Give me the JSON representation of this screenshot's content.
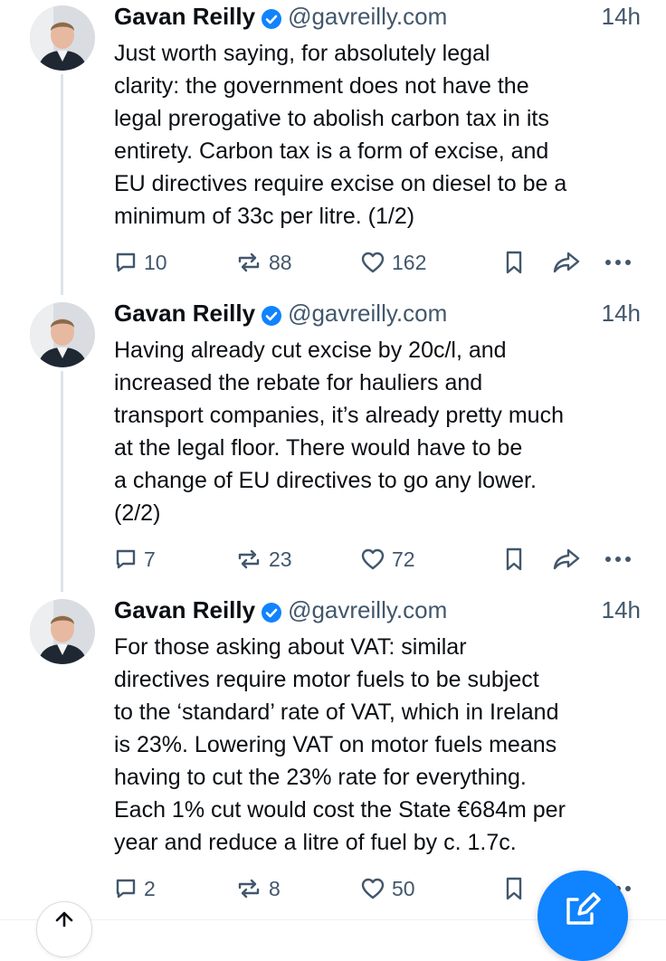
{
  "colors": {
    "accent": "#1083fe",
    "text": "#0b0f14",
    "muted": "#42576c",
    "verified": "#1083fe"
  },
  "posts": [
    {
      "author": "Gavan Reilly",
      "handle": "@gavreilly.com",
      "time": "14h",
      "text": "Just worth saying, for absolutely legal\nclarity: the government does not have the\nlegal prerogative to abolish carbon tax in its\nentirety. Carbon tax is a form of excise, and\nEU directives require excise on diesel to be a\nminimum of 33c per litre. (1/2)",
      "replies": "10",
      "reposts": "88",
      "likes": "162"
    },
    {
      "author": "Gavan Reilly",
      "handle": "@gavreilly.com",
      "time": "14h",
      "text": "Having already cut excise by 20c/l, and\nincreased the rebate for hauliers and\ntransport companies, it’s already pretty much\nat the legal floor. There would have to be\na change of EU directives to go any lower.\n(2/2)",
      "replies": "7",
      "reposts": "23",
      "likes": "72"
    },
    {
      "author": "Gavan Reilly",
      "handle": "@gavreilly.com",
      "time": "14h",
      "text": "For those asking about VAT: similar\ndirectives require motor fuels to be subject\nto the ‘standard’ rate of VAT, which in Ireland\nis 23%. Lowering VAT on motor fuels means\nhaving to cut the 23% rate for everything.\nEach 1% cut would cost the State €684m per\nyear and reduce a litre of fuel by c. 1.7c.",
      "replies": "2",
      "reposts": "8",
      "likes": "50"
    }
  ],
  "icons": {
    "reply": "speech-bubble-icon",
    "repost": "repost-arrows-icon",
    "like": "heart-icon",
    "bookmark": "bookmark-icon",
    "share": "share-arrow-icon",
    "more": "more-dots-icon",
    "verified": "verified-badge-icon",
    "compose": "compose-pencil-icon",
    "scroll_top": "arrow-up-icon"
  }
}
